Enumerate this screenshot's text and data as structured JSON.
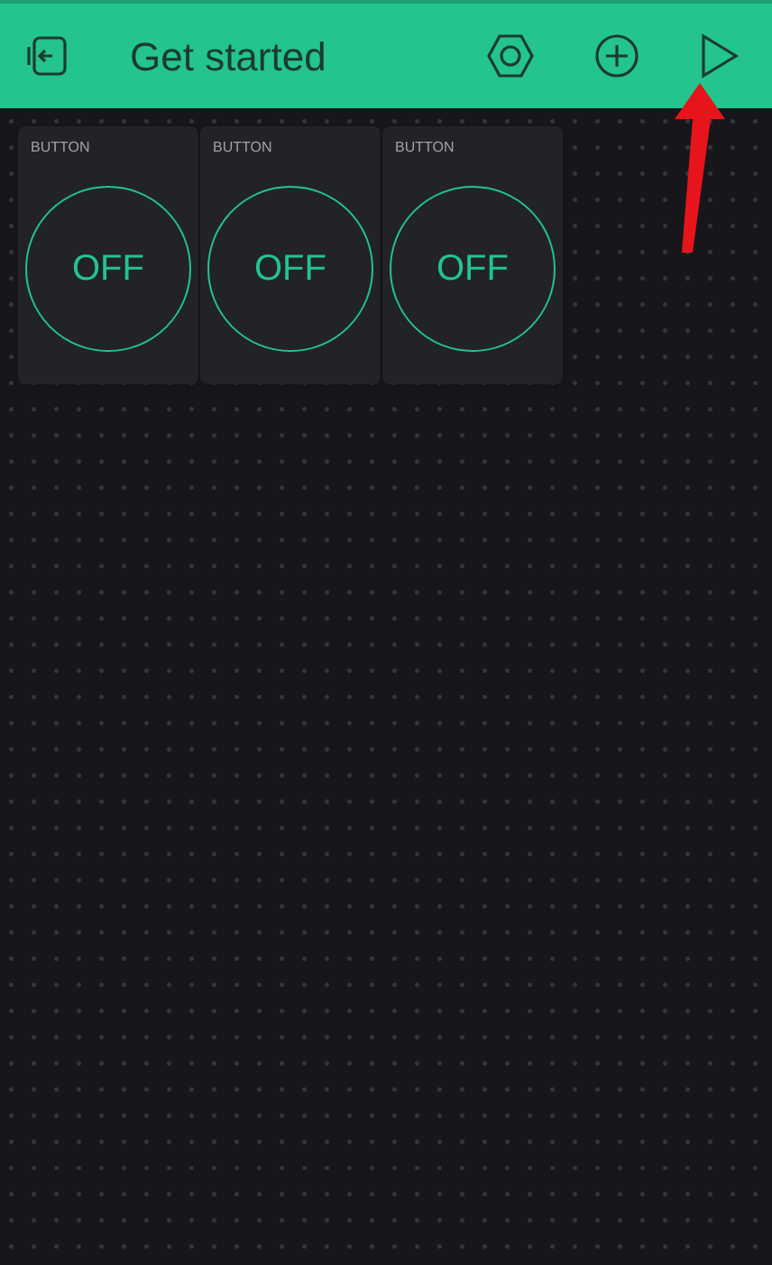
{
  "header": {
    "title": "Get started"
  },
  "widgets": [
    {
      "kind": "button",
      "label": "BUTTON",
      "state_text": "OFF",
      "on": false
    },
    {
      "kind": "button",
      "label": "BUTTON",
      "state_text": "OFF",
      "on": false
    },
    {
      "kind": "button",
      "label": "BUTTON",
      "state_text": "OFF",
      "on": false
    }
  ]
}
